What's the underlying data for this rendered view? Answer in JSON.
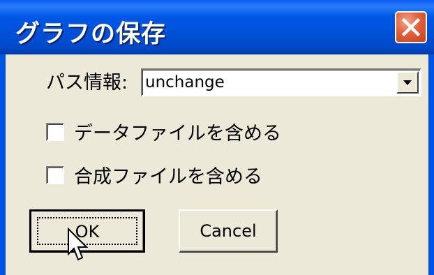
{
  "dialog": {
    "title": "グラフの保存",
    "close_icon": "close-icon"
  },
  "path_info": {
    "label": "パス情報:",
    "value": "unchange",
    "dropdown_icon": "chevron-down-icon"
  },
  "options": [
    {
      "label": "データファイルを含める",
      "checked": false
    },
    {
      "label": "合成ファイルを含める",
      "checked": false
    }
  ],
  "buttons": {
    "ok_label": "OK",
    "cancel_label": "Cancel"
  },
  "colors": {
    "title_bar": "#0054e3",
    "close_button": "#e2603e",
    "dialog_face": "#ece9d8"
  },
  "cursor_icon": "mouse-pointer-icon"
}
